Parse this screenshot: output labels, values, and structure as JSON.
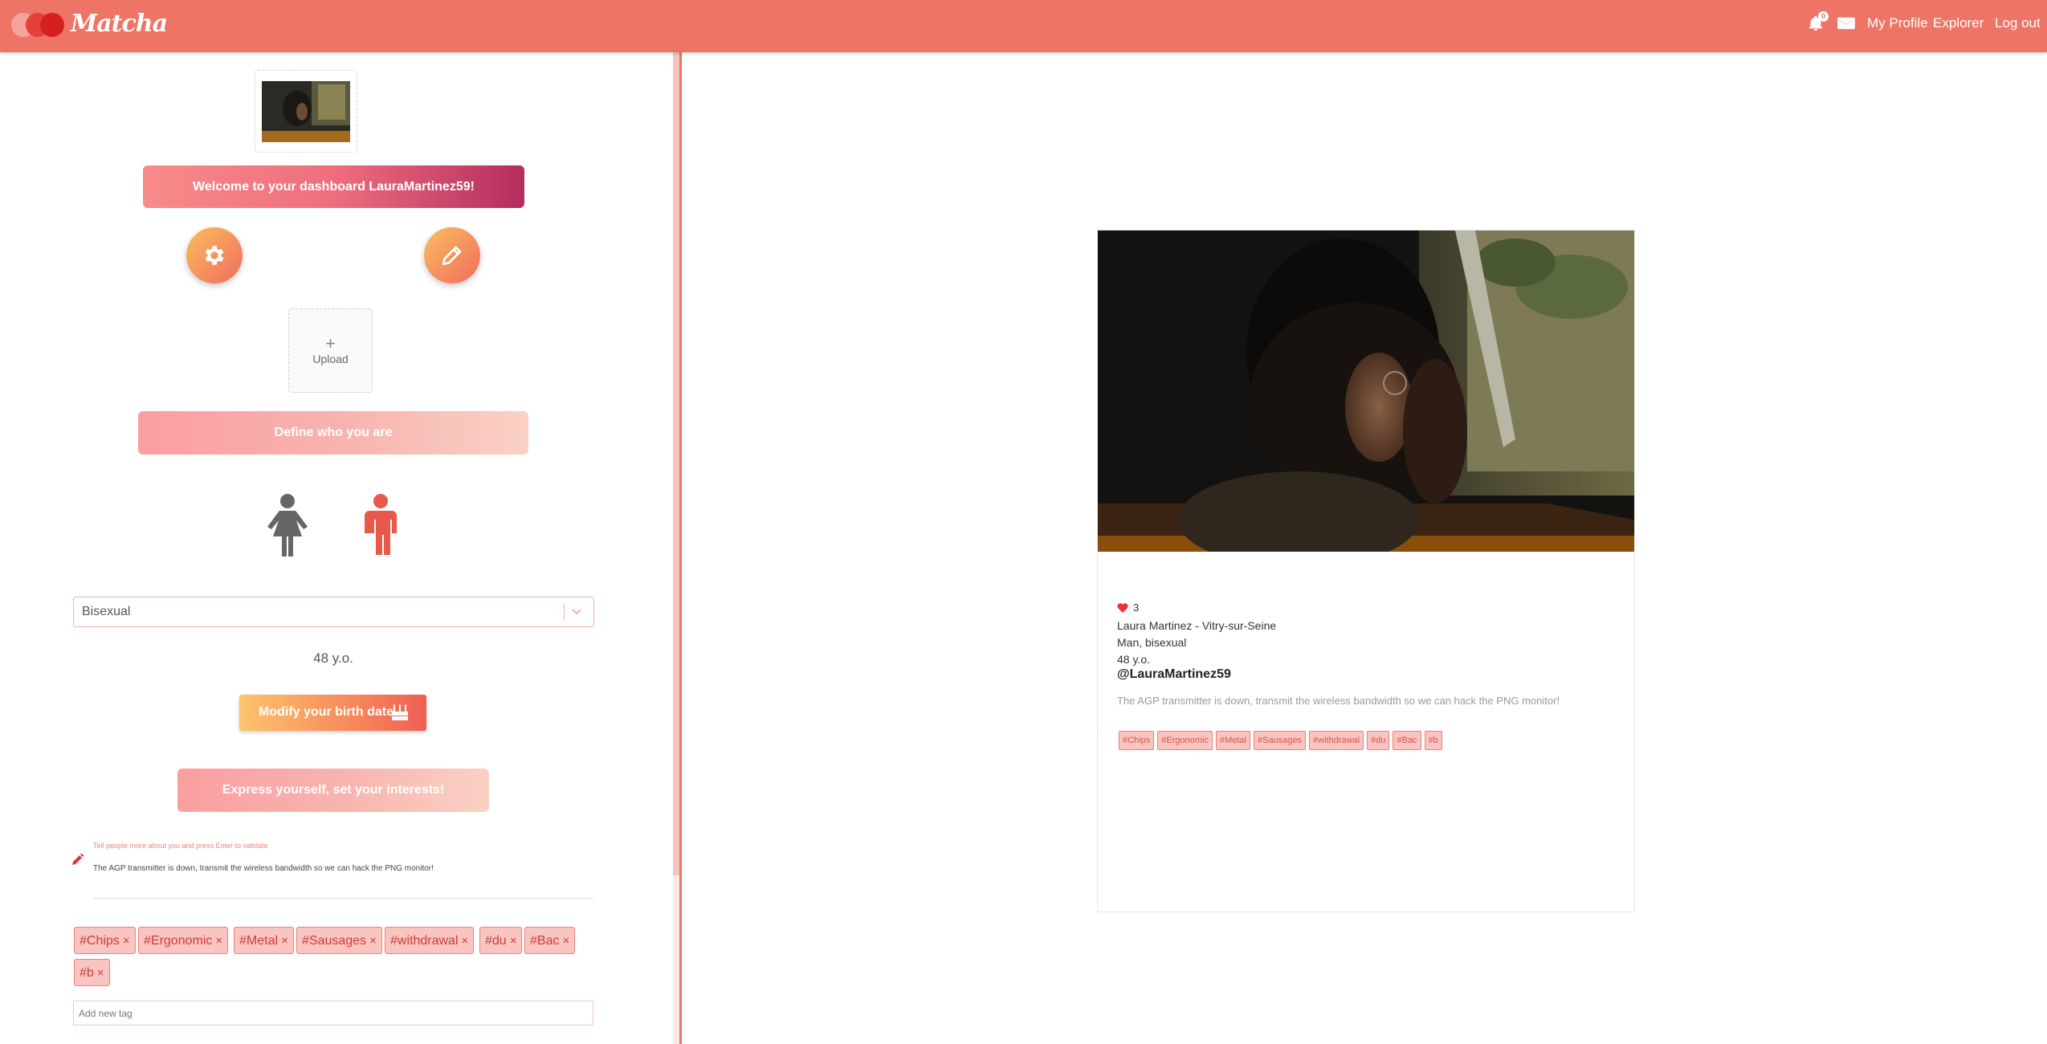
{
  "navbar": {
    "logo_text": "Matcha",
    "notification_count": "0",
    "links": {
      "profile": "My Profile",
      "explorer": "Explorer",
      "logout": "Log out"
    }
  },
  "dashboard": {
    "welcome": "Welcome to your dashboard LauraMartinez59!",
    "upload": {
      "plus": "+",
      "label": "Upload"
    },
    "define_banner": "Define who you are",
    "orientation": {
      "selected": "Bisexual"
    },
    "age": "48 y.o.",
    "birth_button": "Modify your birth date",
    "interests_banner": "Express yourself, set your interests!",
    "bio": {
      "hint": "Tell people more about you and press Enter to validate",
      "text": "The AGP transmitter is down, transmit the wireless bandwidth so we can hack the PNG monitor!"
    },
    "tags": [
      "#Chips",
      "#Ergonomic",
      "#Metal",
      "#Sausages",
      "#withdrawal",
      "#du",
      "#Bac",
      "#b"
    ],
    "remove_symbol": "×",
    "add_tag_placeholder": "Add new tag"
  },
  "profile_card": {
    "likes": "3",
    "name_city": "Laura Martinez - Vitry-sur-Seine",
    "gender_orientation": "Man, bisexual",
    "age": "48 y.o.",
    "username": "@LauraMartinez59",
    "bio": "The AGP transmitter is down, transmit the wireless bandwidth so we can hack the PNG monitor!",
    "tags": [
      "#Chips",
      "#Ergonomic",
      "#Metal",
      "#Sausages",
      "#withdrawal",
      "#du",
      "#Bac",
      "#b"
    ]
  },
  "colors": {
    "navbar": "#ee7465",
    "accent": "#ee7465",
    "selected_gender": "#e8584b",
    "unselected_gender": "#666666",
    "heart": "#e8313c"
  },
  "icons": {
    "bell": "bell-icon",
    "mail": "envelope-icon",
    "settings": "gear-icon",
    "edit": "pencil-icon",
    "female": "female-icon",
    "male": "male-icon",
    "birthday": "cake-icon",
    "heart": "heart-icon",
    "chevron": "chevron-down-icon"
  }
}
